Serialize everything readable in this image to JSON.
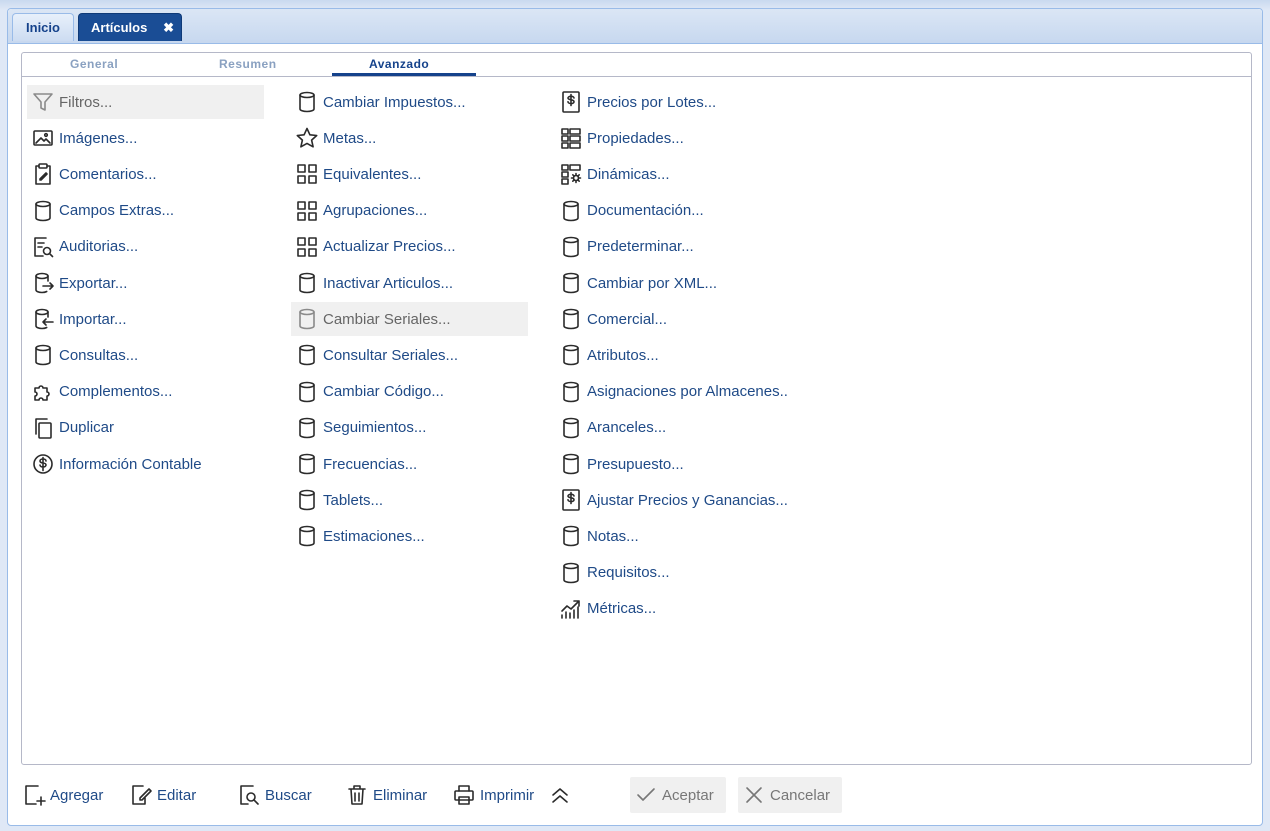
{
  "tabs": {
    "home": "Inicio",
    "articles": "Artículos",
    "close": "✖"
  },
  "subtabs": {
    "general": "General",
    "summary": "Resumen",
    "advanced": "Avanzado"
  },
  "col1": [
    {
      "label": "Filtros...",
      "icon": "filter-icon"
    },
    {
      "label": "Imágenes...",
      "icon": "image-icon"
    },
    {
      "label": "Comentarios...",
      "icon": "clipboard-edit-icon"
    },
    {
      "label": "Campos Extras...",
      "icon": "database-icon"
    },
    {
      "label": "Auditorias...",
      "icon": "audit-search-icon"
    },
    {
      "label": "Exportar...",
      "icon": "database-export-icon"
    },
    {
      "label": "Importar...",
      "icon": "database-import-icon"
    },
    {
      "label": "Consultas...",
      "icon": "database-icon"
    },
    {
      "label": "Complementos...",
      "icon": "puzzle-icon"
    },
    {
      "label": "Duplicar",
      "icon": "copy-icon"
    },
    {
      "label": "Información Contable",
      "icon": "dollar-circle-icon"
    }
  ],
  "col2": [
    {
      "label": "Cambiar Impuestos...",
      "icon": "database-icon"
    },
    {
      "label": "Metas...",
      "icon": "star-icon"
    },
    {
      "label": "Equivalentes...",
      "icon": "grid-icon"
    },
    {
      "label": "Agrupaciones...",
      "icon": "grid-icon"
    },
    {
      "label": "Actualizar Precios...",
      "icon": "grid-icon"
    },
    {
      "label": "Inactivar Articulos...",
      "icon": "database-icon"
    },
    {
      "label": "Cambiar Seriales...",
      "icon": "database-icon"
    },
    {
      "label": "Consultar Seriales...",
      "icon": "database-icon"
    },
    {
      "label": "Cambiar Código...",
      "icon": "database-icon"
    },
    {
      "label": "Seguimientos...",
      "icon": "database-icon"
    },
    {
      "label": "Frecuencias...",
      "icon": "database-icon"
    },
    {
      "label": "Tablets...",
      "icon": "database-icon"
    },
    {
      "label": "Estimaciones...",
      "icon": "database-icon"
    }
  ],
  "col3": [
    {
      "label": "Precios por Lotes...",
      "icon": "dollar-doc-icon"
    },
    {
      "label": "Propiedades...",
      "icon": "list-grid-icon"
    },
    {
      "label": "Dinámicas...",
      "icon": "list-gear-icon"
    },
    {
      "label": "Documentación...",
      "icon": "database-icon"
    },
    {
      "label": "Predeterminar...",
      "icon": "database-icon"
    },
    {
      "label": "Cambiar por XML...",
      "icon": "database-icon"
    },
    {
      "label": "Comercial...",
      "icon": "database-icon"
    },
    {
      "label": "Atributos...",
      "icon": "database-icon"
    },
    {
      "label": "Asignaciones por Almacenes..",
      "icon": "database-icon"
    },
    {
      "label": "Aranceles...",
      "icon": "database-icon"
    },
    {
      "label": "Presupuesto...",
      "icon": "database-icon"
    },
    {
      "label": "Ajustar Precios y Ganancias...",
      "icon": "dollar-doc-icon"
    },
    {
      "label": "Notas...",
      "icon": "database-icon"
    },
    {
      "label": "Requisitos...",
      "icon": "database-icon"
    },
    {
      "label": "Métricas...",
      "icon": "chart-up-icon"
    }
  ],
  "toolbar": {
    "add": "Agregar",
    "edit": "Editar",
    "search": "Buscar",
    "delete": "Eliminar",
    "print": "Imprimir",
    "accept": "Aceptar",
    "cancel": "Cancelar"
  }
}
